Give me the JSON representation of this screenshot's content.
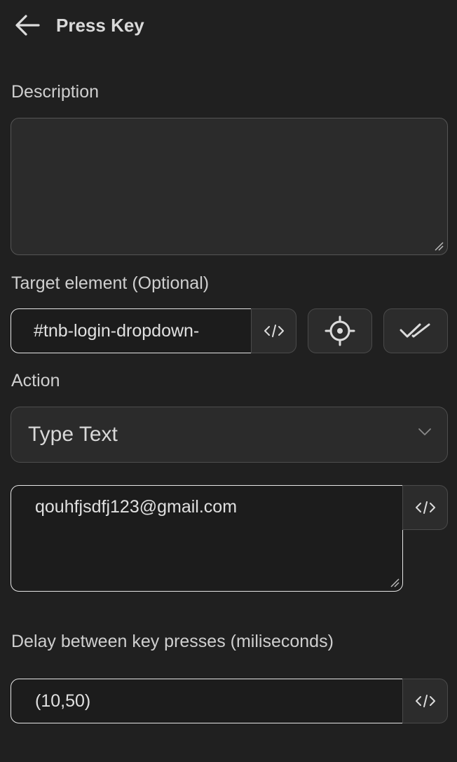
{
  "header": {
    "title": "Press Key",
    "back_icon": "arrow-left-icon"
  },
  "description": {
    "label": "Description",
    "value": ""
  },
  "target": {
    "label": "Target element (Optional)",
    "value": "#tnb-login-dropdown-",
    "code_icon": "code-icon",
    "pick_icon": "crosshair-icon",
    "validate_icon": "double-check-icon"
  },
  "action": {
    "label": "Action",
    "selected": "Type Text",
    "text_value": "qouhfjsdfj123@gmail.com"
  },
  "delay": {
    "label": "Delay between key presses (miliseconds)",
    "value": "(10,50)"
  },
  "colors": {
    "background": "#202020",
    "input_focus_border": "#e6e6e6",
    "text": "#d6d6d6"
  }
}
